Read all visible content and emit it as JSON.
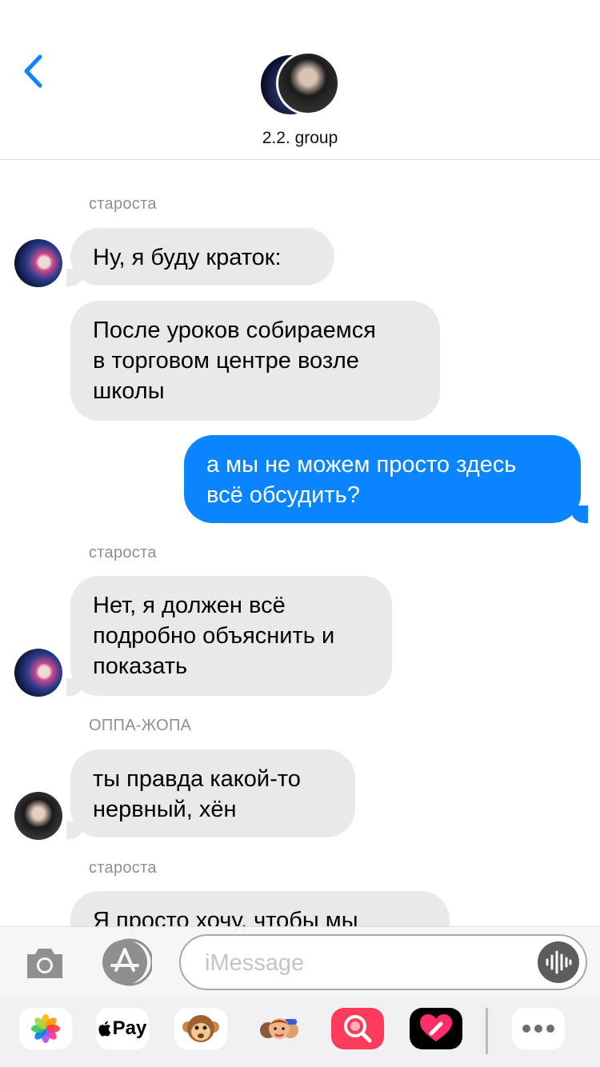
{
  "header": {
    "group_name": "2.2. group",
    "back_label": "Back"
  },
  "messages": [
    {
      "sender": "староста"
    },
    {
      "text": "Ну, я буду краток:"
    },
    {
      "text_lines": [
        "После уроков собираемся",
        "в торговом центре возле",
        "школы"
      ]
    },
    {
      "text_lines": [
        "а мы не можем просто здесь",
        "всё обсудить?"
      ]
    },
    {
      "sender": "староста"
    },
    {
      "text_lines": [
        "Нет, я должен всё",
        "подробно объяснить и",
        "показать"
      ]
    },
    {
      "sender": "ОППА-ЖОПА"
    },
    {
      "text_lines": [
        "ты правда какой-то",
        "нервный, хён"
      ]
    },
    {
      "sender": "староста"
    },
    {
      "text": "Я просто хочу, чтобы мы"
    }
  ],
  "input": {
    "placeholder": "iMessage"
  },
  "drawer": {
    "apple_pay_label": "Pay",
    "items": [
      "photos-icon",
      "apple-pay-icon",
      "animoji-icon",
      "memoji-icon",
      "search-images-icon",
      "digital-touch-icon",
      "more-icon"
    ]
  },
  "colors": {
    "outgoing_bubble": "#0a84ff",
    "incoming_bubble": "#e9e9eb",
    "accent": "#0a84ff"
  }
}
